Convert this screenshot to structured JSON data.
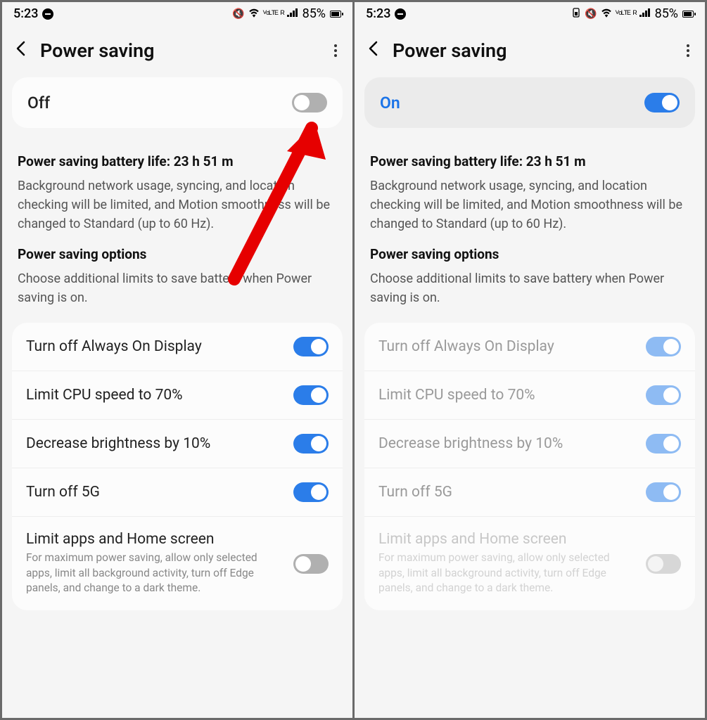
{
  "left": {
    "status": {
      "time": "5:23",
      "battery": "85%",
      "net": "ᯤ ᶜᵗᴱ ᴿ ⫰ıll"
    },
    "header": {
      "title": "Power saving"
    },
    "master": {
      "label": "Off",
      "on": false
    },
    "info": {
      "battery_life_line": "Power saving battery life: 23 h 51 m",
      "desc": "Background network usage, syncing, and location checking will be limited, and Motion smoothness will be changed to Standard (up to 60 Hz).",
      "options_heading": "Power saving options",
      "options_desc": "Choose additional limits to save battery when Power saving is on."
    },
    "options": [
      {
        "label": "Turn off Always On Display",
        "on": true
      },
      {
        "label": "Limit CPU speed to 70%",
        "on": true
      },
      {
        "label": "Decrease brightness by 10%",
        "on": true
      },
      {
        "label": "Turn off 5G",
        "on": true
      },
      {
        "label": "Limit apps and Home screen",
        "sub": "For maximum power saving, allow only selected apps, limit all background activity, turn off Edge panels, and change to a dark theme.",
        "on": false
      }
    ]
  },
  "right": {
    "status": {
      "time": "5:23",
      "battery": "85%",
      "net": "ᯤ ᶜᵗᴱ ᴿ ⫰ıll"
    },
    "header": {
      "title": "Power saving"
    },
    "master": {
      "label": "On",
      "on": true
    },
    "info": {
      "battery_life_line": "Power saving battery life: 23 h 51 m",
      "desc": "Background network usage, syncing, and location checking will be limited, and Motion smoothness will be changed to Standard (up to 60 Hz).",
      "options_heading": "Power saving options",
      "options_desc": "Choose additional limits to save battery when Power saving is on."
    },
    "options": [
      {
        "label": "Turn off Always On Display",
        "on": true,
        "dim": true
      },
      {
        "label": "Limit CPU speed to 70%",
        "on": true,
        "dim": true
      },
      {
        "label": "Decrease brightness by 10%",
        "on": true,
        "dim": true
      },
      {
        "label": "Turn off 5G",
        "on": true,
        "dim": true
      },
      {
        "label": "Limit apps and Home screen",
        "sub": "For maximum power saving, allow only selected apps, limit all background activity, turn off Edge panels, and change to a dark theme.",
        "on": false,
        "dim": true
      }
    ]
  }
}
